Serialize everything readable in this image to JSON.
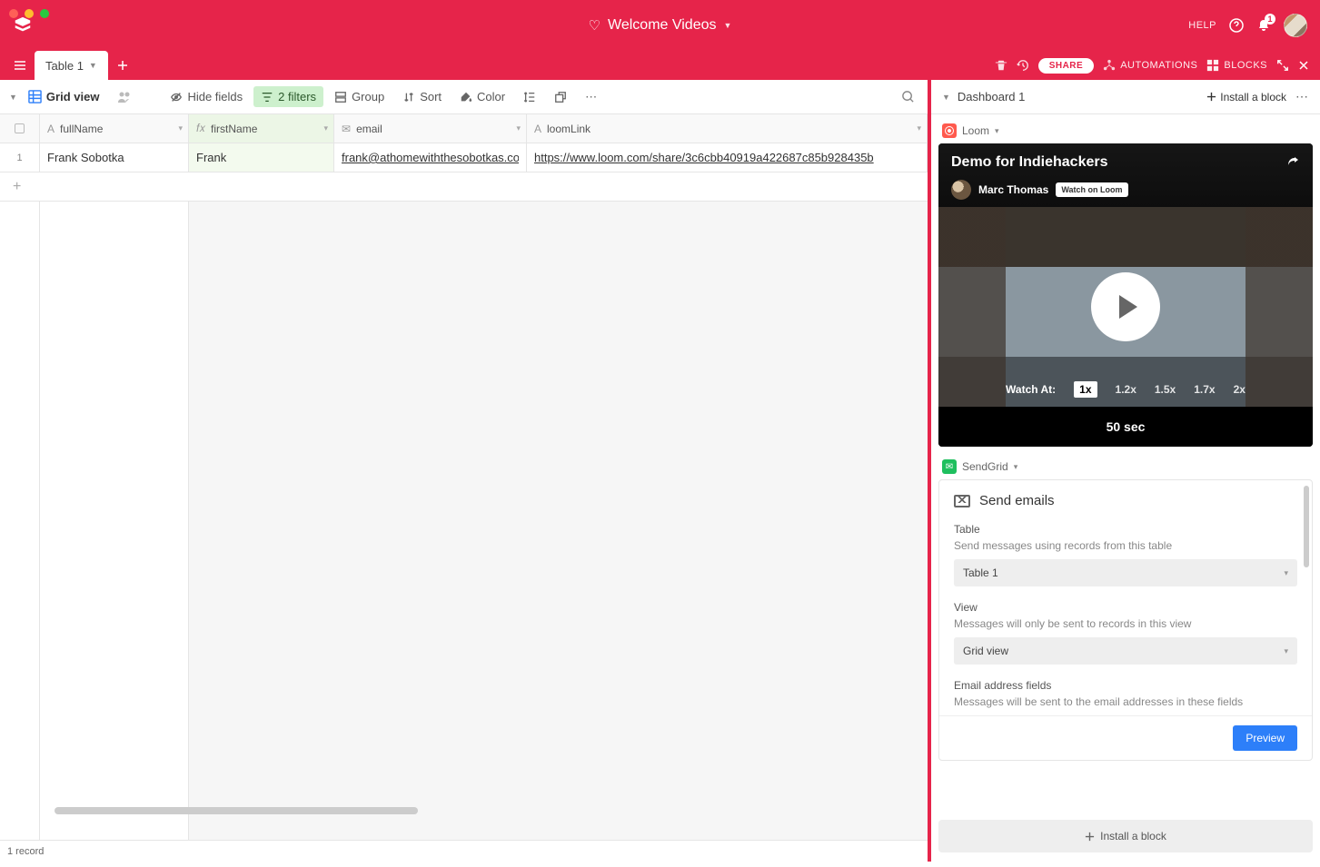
{
  "header": {
    "title": "Welcome Videos",
    "help": "HELP",
    "notification_count": "1"
  },
  "tabbar": {
    "tab1": "Table 1",
    "share": "SHARE",
    "automations": "AUTOMATIONS",
    "blocks": "BLOCKS"
  },
  "viewbar": {
    "view_name": "Grid view",
    "hide_fields": "Hide fields",
    "filters": "2 filters",
    "group": "Group",
    "sort": "Sort",
    "color": "Color"
  },
  "columns": {
    "fullName": "fullName",
    "firstName": "firstName",
    "email": "email",
    "loomLink": "loomLink"
  },
  "rows": [
    {
      "num": "1",
      "fullName": "Frank Sobotka",
      "firstName": "Frank",
      "email": "frank@athomewiththesobotkas.co",
      "loomLink": "https://www.loom.com/share/3c6cbb40919a422687c85b928435b"
    }
  ],
  "status": {
    "records": "1 record"
  },
  "sidepanel": {
    "title": "Dashboard 1",
    "install": "Install a block",
    "loom_label": "Loom",
    "sendgrid_label": "SendGrid"
  },
  "loom": {
    "title": "Demo for Indiehackers",
    "author": "Marc Thomas",
    "watch_badge": "Watch on Loom",
    "speed_label": "Watch At:",
    "speeds": [
      "1x",
      "1.2x",
      "1.5x",
      "1.7x",
      "2x"
    ],
    "duration": "50 sec"
  },
  "sendgrid": {
    "title": "Send emails",
    "table_label": "Table",
    "table_desc": "Send messages using records from this table",
    "table_value": "Table 1",
    "view_label": "View",
    "view_desc": "Messages will only be sent to records in this view",
    "view_value": "Grid view",
    "email_label": "Email address fields",
    "email_desc": "Messages will be sent to the email addresses in these fields",
    "preview": "Preview"
  },
  "footer": {
    "install": "Install a block"
  }
}
